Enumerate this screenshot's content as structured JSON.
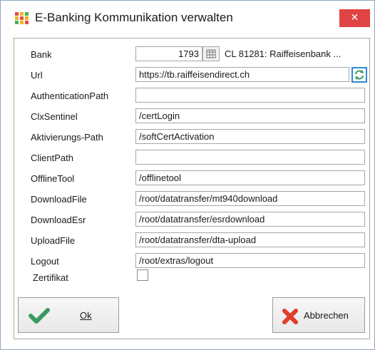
{
  "window": {
    "title": "E-Banking Kommunikation verwalten",
    "close_glyph": "✕",
    "colors": {
      "close_bg": "#e04343",
      "focus_border": "#2b8ad6",
      "ok_check": "#3a9a63",
      "cancel_x": "#e23d28"
    }
  },
  "form": {
    "bank": {
      "label": "Bank",
      "number": "1793",
      "name": "CL 81281: Raiffeisenbank ..."
    },
    "url": {
      "label": "Url",
      "value": "https://tb.raiffeisendirect.ch"
    },
    "authentication_path": {
      "label": "AuthenticationPath",
      "value": ""
    },
    "clx_sentinel": {
      "label": "ClxSentinel",
      "value": "/certLogin"
    },
    "aktivierungs_path": {
      "label": "Aktivierungs-Path",
      "value": "/softCertActivation"
    },
    "client_path": {
      "label": "ClientPath",
      "value": ""
    },
    "offline_tool": {
      "label": "OfflineTool",
      "value": "/offlinetool"
    },
    "download_file": {
      "label": "DownloadFile",
      "value": "/root/datatransfer/mt940download"
    },
    "download_esr": {
      "label": "DownloadEsr",
      "value": "/root/datatransfer/esrdownload"
    },
    "upload_file": {
      "label": "UploadFile",
      "value": "/root/datatransfer/dta-upload"
    },
    "logout": {
      "label": "Logout",
      "value": "/root/extras/logout"
    },
    "zertifikat": {
      "label": "Zertifikat",
      "checked": false
    }
  },
  "buttons": {
    "ok": {
      "label": "Ok",
      "icon": "checkmark-icon"
    },
    "cancel": {
      "label": "Abbrechen",
      "icon": "cancel-x-icon"
    }
  }
}
